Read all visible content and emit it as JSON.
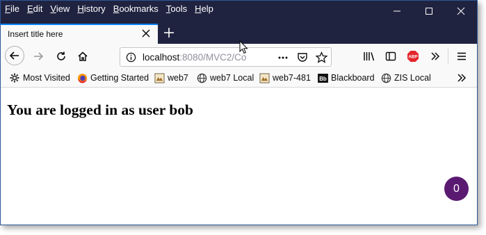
{
  "menu": [
    "File",
    "Edit",
    "View",
    "History",
    "Bookmarks",
    "Tools",
    "Help"
  ],
  "tab": {
    "title": "Insert title here"
  },
  "url": {
    "host": "localhost",
    "rest": ":8080/MVC2/Co"
  },
  "bookmarks": [
    {
      "label": "Most Visited",
      "icon": "gear-icon"
    },
    {
      "label": "Getting Started",
      "icon": "firefox-icon"
    },
    {
      "label": "web7",
      "icon": "web7-icon"
    },
    {
      "label": "web7 Local",
      "icon": "globe-icon"
    },
    {
      "label": "web7-481",
      "icon": "web7-icon"
    },
    {
      "label": "Blackboard",
      "icon": "blackboard-icon"
    },
    {
      "label": "ZIS Local",
      "icon": "globe-icon"
    }
  ],
  "content": {
    "message": "You are logged in as user bob"
  },
  "badge": {
    "count": "0"
  },
  "toolbar": {
    "abp_label": "ABP"
  },
  "colors": {
    "titlebar": "#202340",
    "accent": "#0a84ff",
    "badge": "#5b1a72"
  }
}
